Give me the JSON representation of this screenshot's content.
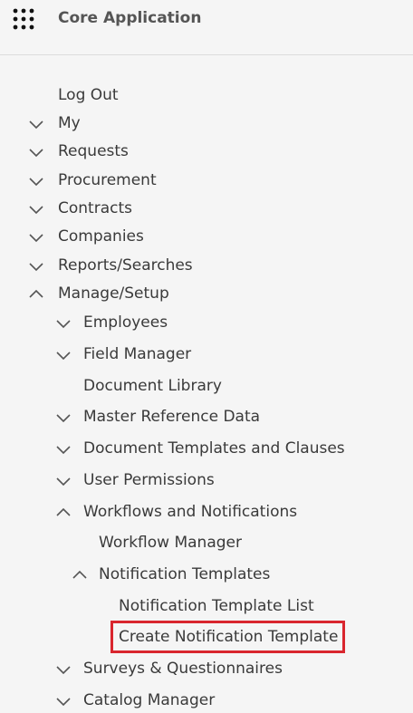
{
  "header": {
    "title": "Core Application",
    "apps_icon": "grid-dots-icon"
  },
  "menu": {
    "log_out": "Log Out",
    "my": "My",
    "requests": "Requests",
    "procurement": "Procurement",
    "contracts": "Contracts",
    "companies": "Companies",
    "reports_searches": "Reports/Searches",
    "manage_setup": "Manage/Setup",
    "employees": "Employees",
    "field_manager": "Field Manager",
    "document_library": "Document Library",
    "master_reference_data": "Master Reference Data",
    "document_templates_clauses": "Document Templates and Clauses",
    "user_permissions": "User Permissions",
    "workflows_notifications": "Workflows and Notifications",
    "workflow_manager": "Workflow Manager",
    "notification_templates": "Notification Templates",
    "notification_template_list": "Notification Template List",
    "create_notification_template": "Create Notification Template",
    "surveys_questionnaires": "Surveys & Questionnaires",
    "catalog_manager": "Catalog Manager"
  },
  "colors": {
    "highlight": "#d9262e",
    "background": "#f5f5f5",
    "text": "#3a3a3a"
  }
}
